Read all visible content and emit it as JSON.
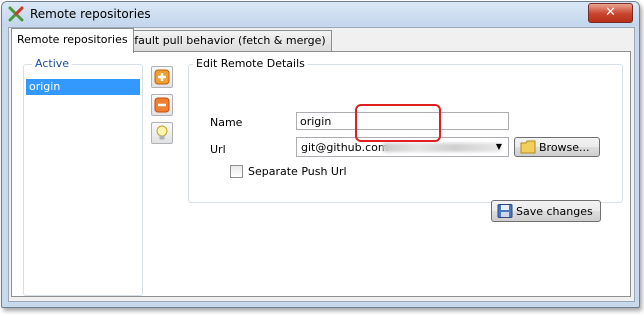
{
  "window": {
    "title": "Remote repositories",
    "close_glyph": "✕"
  },
  "tabs": [
    {
      "label": "Remote repositories",
      "active": true
    },
    {
      "label": "Default pull behavior (fetch & merge)",
      "active": false
    }
  ],
  "active_list": {
    "legend": "Active",
    "items": [
      "origin"
    ]
  },
  "side_buttons": {
    "add": "add-icon",
    "remove": "remove-icon",
    "default": "lightbulb-icon"
  },
  "details": {
    "legend": "Edit Remote Details",
    "name_label": "Name",
    "name_value": "origin",
    "url_label": "Url",
    "url_value": "git@github.com",
    "browse_label": "Browse...",
    "separate_push_label": "Separate Push Url",
    "separate_push_checked": false,
    "save_label": "Save changes"
  },
  "colors": {
    "selection": "#3399ff",
    "highlight": "#e02020",
    "close": "#c8432c"
  }
}
